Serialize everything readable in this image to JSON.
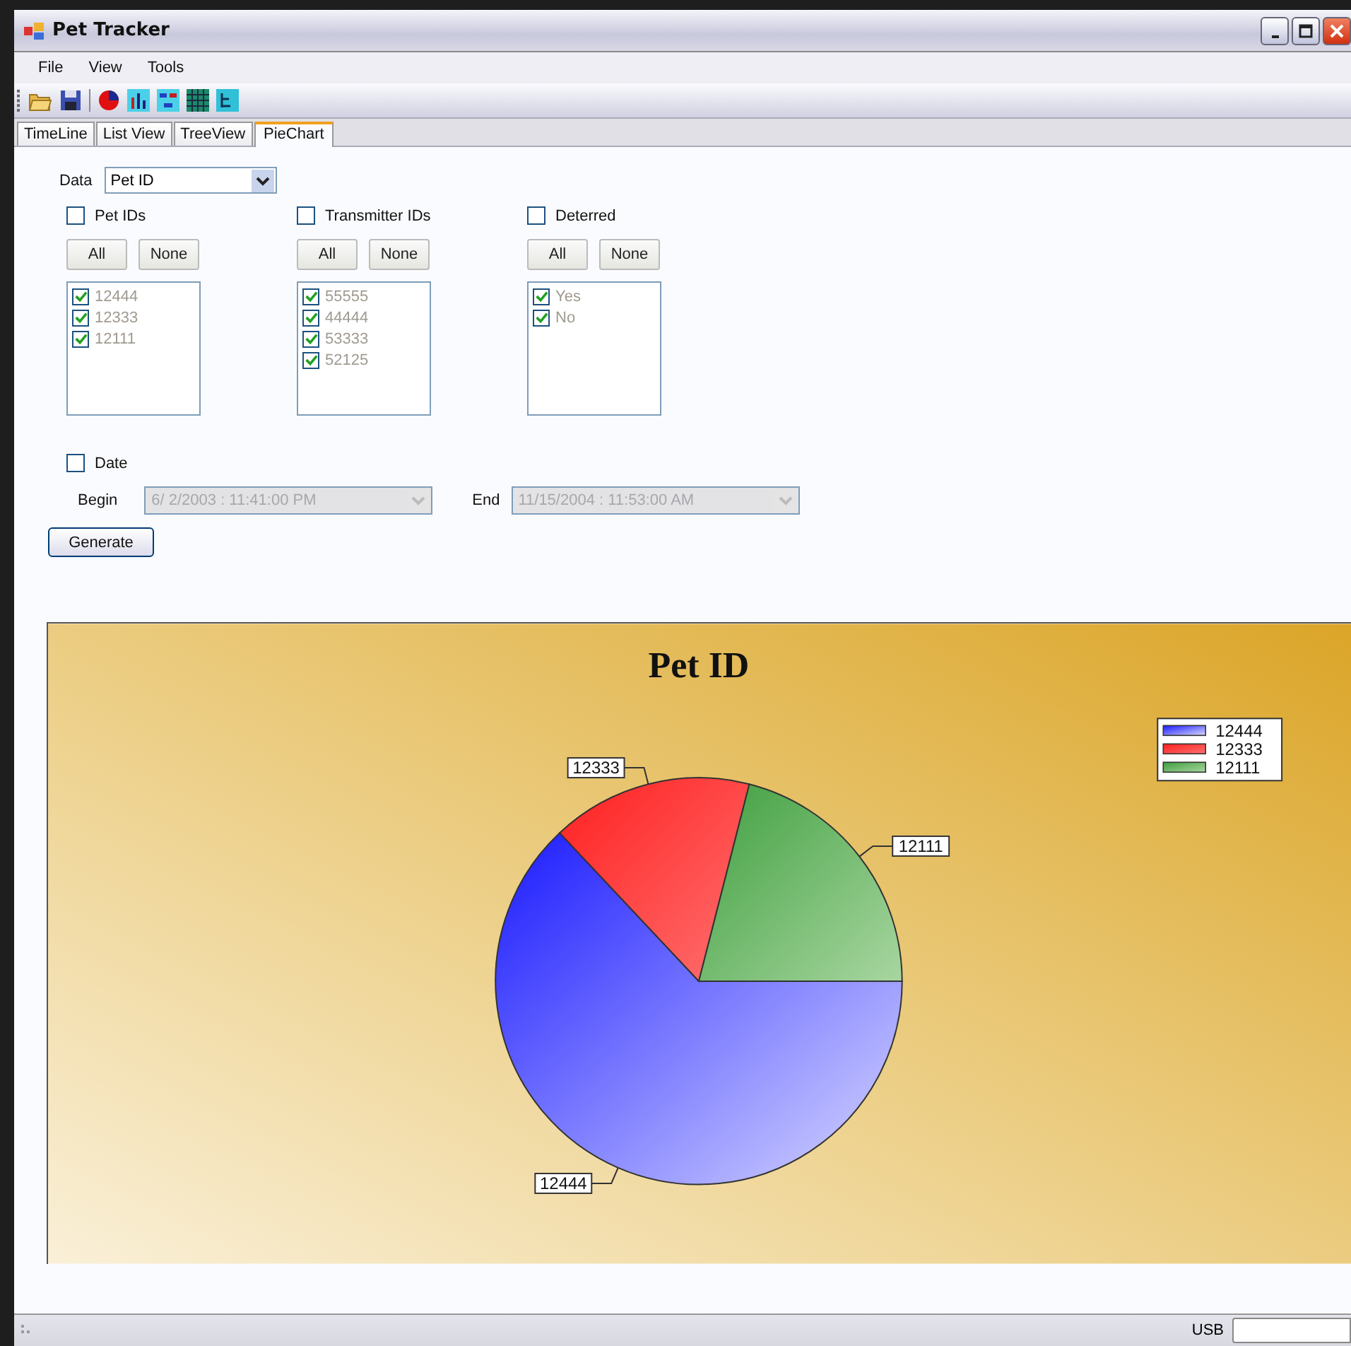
{
  "window": {
    "title": "Pet Tracker"
  },
  "menu": [
    "File",
    "View",
    "Tools"
  ],
  "tabs": [
    {
      "label": "TimeLine",
      "selected": false
    },
    {
      "label": "List View",
      "selected": false
    },
    {
      "label": "TreeView",
      "selected": false
    },
    {
      "label": "PieChart",
      "selected": true
    }
  ],
  "data_selector": {
    "label": "Data",
    "value": "Pet ID"
  },
  "filters": [
    {
      "label": "Pet IDs",
      "checked": false,
      "buttons": [
        "All",
        "None"
      ],
      "items": [
        {
          "label": "12444",
          "checked": true
        },
        {
          "label": "12333",
          "checked": true
        },
        {
          "label": "12111",
          "checked": true
        }
      ]
    },
    {
      "label": "Transmitter IDs",
      "checked": false,
      "buttons": [
        "All",
        "None"
      ],
      "items": [
        {
          "label": "55555",
          "checked": true
        },
        {
          "label": "44444",
          "checked": true
        },
        {
          "label": "53333",
          "checked": true
        },
        {
          "label": "52125",
          "checked": true
        }
      ]
    },
    {
      "label": "Deterred",
      "checked": false,
      "buttons": [
        "All",
        "None"
      ],
      "items": [
        {
          "label": "Yes",
          "checked": true
        },
        {
          "label": "No",
          "checked": true
        }
      ]
    }
  ],
  "date": {
    "label": "Date",
    "checked": false,
    "begin": {
      "label": "Begin",
      "value": "6/  2/2003 : 11:41:00 PM"
    },
    "end": {
      "label": "End",
      "value": "11/15/2004 : 11:53:00 AM"
    }
  },
  "generate_button": "Generate",
  "chart": {
    "chart_data": {
      "type": "pie",
      "title": "Pet ID",
      "categories": [
        "12444",
        "12333",
        "12111"
      ],
      "values": [
        63,
        16,
        21
      ],
      "legend": "top right"
    }
  },
  "status_bar": {
    "label": "USB"
  }
}
